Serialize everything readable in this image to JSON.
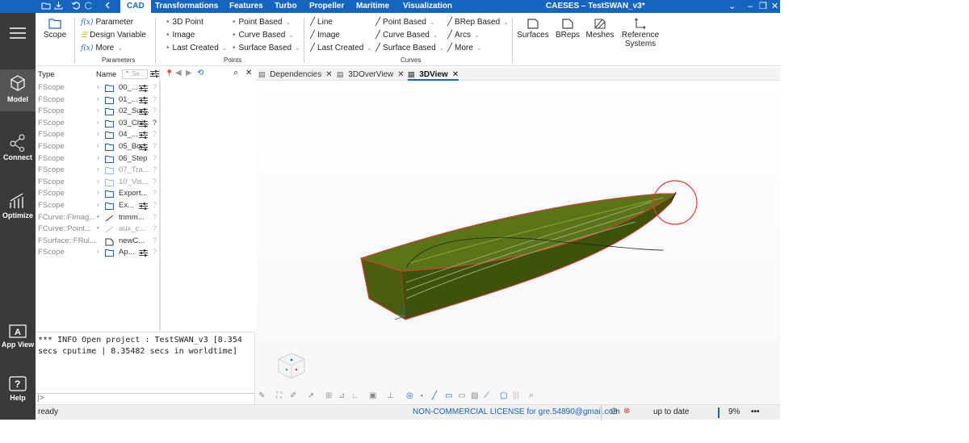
{
  "window": {
    "title": "CAESES – TestSWAN_v3*"
  },
  "menu": {
    "tabs": [
      "CAD",
      "Transformations",
      "Features",
      "Turbo",
      "Propeller",
      "Maritime",
      "Visualization"
    ]
  },
  "ribbon": {
    "scope_label": "Scope",
    "parameters": {
      "parameter": "Parameter",
      "design_variable": "Design Variable",
      "more": "More",
      "group_label": "Parameters"
    },
    "points": {
      "point_3d": "3D Point",
      "image": "Image",
      "last_created": "Last Created",
      "point_based": "Point Based",
      "curve_based": "Curve Based",
      "surface_based": "Surface Based",
      "group_label": "Points"
    },
    "curves": {
      "line": "Line",
      "image": "Image",
      "last_created": "Last Created",
      "point_based": "Point Based",
      "curve_based": "Curve Based",
      "surface_based": "Surface Based",
      "brep_based": "BRep Based",
      "arcs": "Arcs",
      "more": "More",
      "group_label": "Curves"
    },
    "big_buttons": {
      "surfaces": "Surfaces",
      "breps": "BReps",
      "meshes": "Meshes",
      "reference_systems_1": "Reference",
      "reference_systems_2": "Systems"
    }
  },
  "sidebar": {
    "items": [
      "Model",
      "Connect",
      "Optimize",
      "App View",
      "Help"
    ]
  },
  "tree": {
    "col_type": "Type",
    "col_name": "Name",
    "search_placeholder": "Se...",
    "rows": [
      {
        "type": "FScope",
        "name": "00_..."
      },
      {
        "type": "FScope",
        "name": "01_..."
      },
      {
        "type": "FScope",
        "name": "02_Sur..."
      },
      {
        "type": "FScope",
        "name": "03_Chi..."
      },
      {
        "type": "FScope",
        "name": "04_..."
      },
      {
        "type": "FScope",
        "name": "05_Bo..."
      },
      {
        "type": "FScope",
        "name": "06_Step"
      },
      {
        "type": "FScope",
        "name": "07_Tra..."
      },
      {
        "type": "FScope",
        "name": "10_Vis..."
      },
      {
        "type": "FScope",
        "name": "Export..."
      },
      {
        "type": "FScope",
        "name": "Ex..."
      },
      {
        "type": "FCurve::FImag...",
        "name": "trimm..."
      },
      {
        "type": "FCurve::Point...",
        "name": "aux_c..."
      },
      {
        "type": "FSurface::FRul...",
        "name": "newC..."
      },
      {
        "type": "FScope",
        "name": "Ap..."
      }
    ]
  },
  "console": {
    "text": "*** INFO Open project : TestSWAN_v3 [8.354 secs cputime | 8.35482 secs in worldtime]",
    "prompt": "|>"
  },
  "doc_tabs": [
    "Dependencies",
    "3DOverView",
    "3DView"
  ],
  "statusbar": {
    "left": "ready",
    "license": "NON-COMMERCIAL LICENSE for gre.54890@gmail.com",
    "state": "up to date",
    "percent": "9%",
    "more": "•••"
  },
  "colors": {
    "accent": "#1565c0",
    "hull": "#556b16",
    "edge": "#e53935"
  }
}
